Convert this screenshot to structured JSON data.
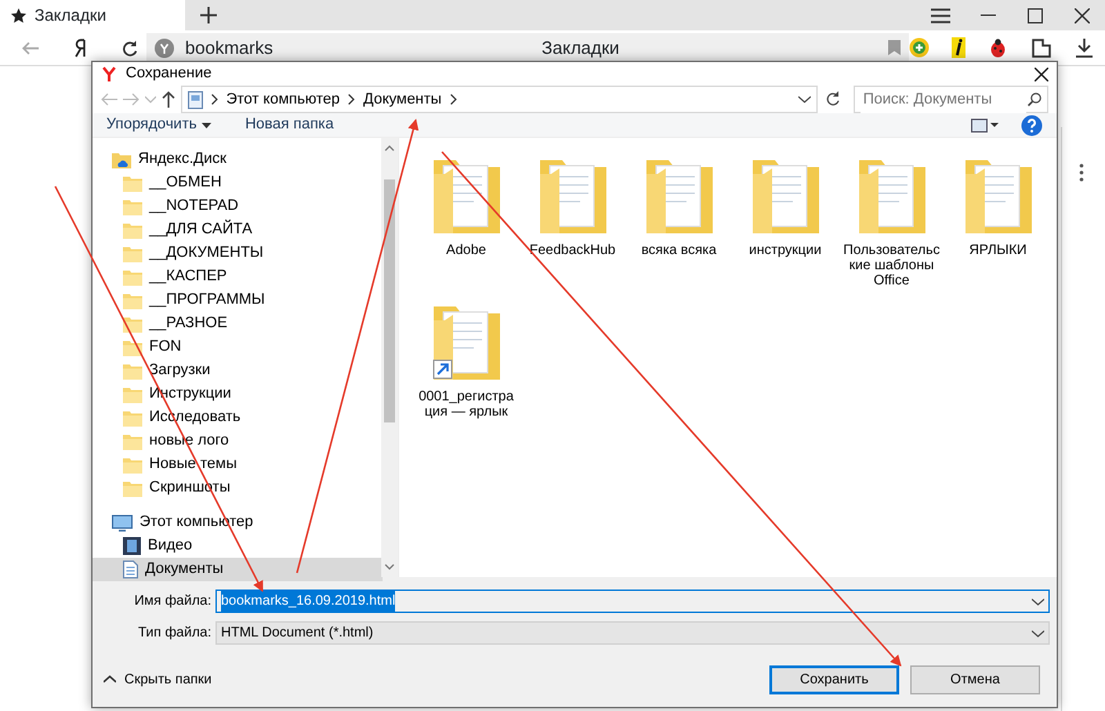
{
  "browser": {
    "tab": {
      "title": "Закладки",
      "selected": true
    },
    "address": {
      "text": "bookmarks",
      "page_title": "Закладки"
    }
  },
  "dialog": {
    "title": "Сохранение",
    "breadcrumb": [
      "Этот компьютер",
      "Документы"
    ],
    "search": {
      "placeholder": "Поиск: Документы"
    },
    "toolbar": [
      "Упорядочить",
      "Новая папка"
    ],
    "nav_tree": [
      {
        "label": "Яндекс.Диск",
        "kind": "cloud",
        "selected": false,
        "children": [
          {
            "label": "__ОБМЕН",
            "kind": "folder",
            "selected": false
          },
          {
            "label": "__NOTEPAD",
            "kind": "folder",
            "selected": false
          },
          {
            "label": "__ДЛЯ САЙТА",
            "kind": "folder",
            "selected": false
          },
          {
            "label": "__ДОКУМЕНТЫ",
            "kind": "folder",
            "selected": false
          },
          {
            "label": "__КАСПЕР",
            "kind": "folder",
            "selected": false
          },
          {
            "label": "__ПРОГРАММЫ",
            "kind": "folder",
            "selected": false
          },
          {
            "label": "__РАЗНОЕ",
            "kind": "folder",
            "selected": false
          },
          {
            "label": "FON",
            "kind": "folder",
            "selected": false
          },
          {
            "label": "Загрузки",
            "kind": "folder",
            "selected": false
          },
          {
            "label": "Инструкции",
            "kind": "folder",
            "selected": false
          },
          {
            "label": "Исследовать",
            "kind": "folder",
            "selected": false
          },
          {
            "label": "новые лого",
            "kind": "folder",
            "selected": false
          },
          {
            "label": "Новые темы",
            "kind": "folder",
            "selected": false
          },
          {
            "label": "Скриншоты",
            "kind": "folder",
            "selected": false
          }
        ]
      },
      {
        "label": "Этот компьютер",
        "kind": "computer",
        "selected": false,
        "children": [
          {
            "label": "Видео",
            "kind": "video",
            "selected": false
          },
          {
            "label": "Документы",
            "kind": "documents",
            "selected": true
          }
        ]
      }
    ],
    "files": [
      {
        "name": "Adobe",
        "shortcut": false
      },
      {
        "name": "FeedbackHub",
        "shortcut": false
      },
      {
        "name": "всяка всяка",
        "shortcut": false
      },
      {
        "name": "инструкции",
        "shortcut": false
      },
      {
        "name": "Пользовательские шаблоны Office",
        "shortcut": false
      },
      {
        "name": "ЯРЛЫКИ",
        "shortcut": false
      },
      {
        "name": "0001_регистрация — ярлык",
        "shortcut": true
      }
    ],
    "filename": {
      "label": "Имя файла:",
      "value": "bookmarks_16.09.2019.html",
      "text_selected": true
    },
    "filetype": {
      "label": "Тип файла:",
      "value": "HTML Document (*.html)"
    },
    "hide_folders": "Скрыть папки",
    "buttons": [
      {
        "label": "Сохранить",
        "default": true
      },
      {
        "label": "Отмена",
        "default": false
      }
    ]
  }
}
